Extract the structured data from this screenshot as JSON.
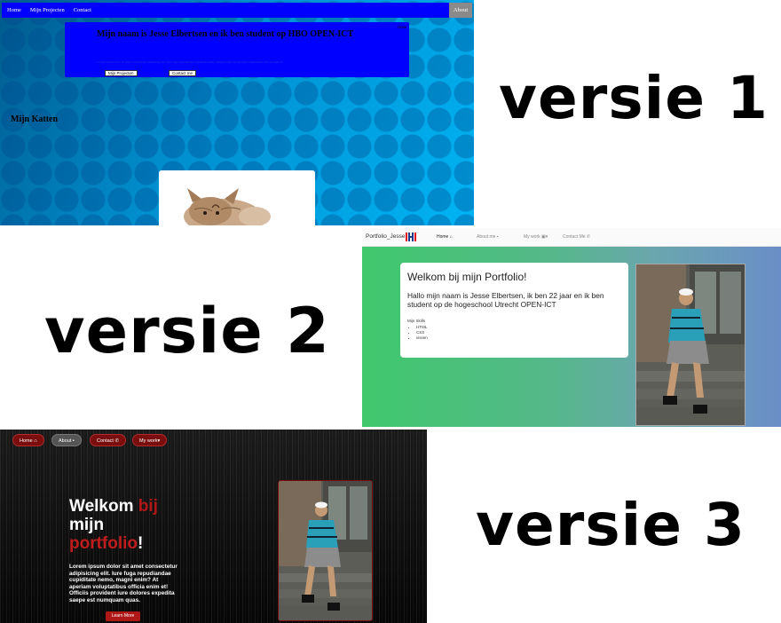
{
  "labels": {
    "versie1": "versie 1",
    "versie2": "versie 2",
    "versie3": "versie 3"
  },
  "v1": {
    "nav": [
      "Home",
      "Mijn Projecten",
      "Contact"
    ],
    "about": "About",
    "hero_title": "Mijn naam is Jesse Elbertsen en ik ben student op HBO OPEN-ICT",
    "close": "close",
    "hero_text": "Lorem ipsum dolor sit amet consectetur adipisicing elit. Iure fuga repudiandae cupiditate nemo, magni enim? At aperiam voluptatibus officia enim et!",
    "btn_projects": "Mijn Projecten",
    "btn_contact": "Contact me",
    "cats_title": "Mijn Katten",
    "colors": {
      "nav": "#0000ff",
      "background": "#00aaee"
    }
  },
  "v2": {
    "brand": "Portfolio_Jesse",
    "nav": [
      {
        "label": "Home",
        "icon": "home-icon"
      },
      {
        "label": "About me",
        "icon": "user-icon"
      },
      {
        "label": "My work",
        "icon": "image-icon"
      },
      {
        "label": "Contact Me",
        "icon": "phone-icon"
      }
    ],
    "card_title": "Welkom bij mijn Portfolio!",
    "card_intro": "Hallo mijn naam is Jesse Elbertsen, ik ben 22 jaar en ik ben student op de hogeschool Utrecht OPEN-ICT",
    "skills_title": "Mijn Skills",
    "skills": [
      "HTML",
      "CSS",
      "vissen"
    ],
    "colors": {
      "gradient_start": "#40c86c",
      "gradient_end": "#6a8ec8"
    }
  },
  "v3": {
    "nav": [
      {
        "label": "Home",
        "icon": "home-icon"
      },
      {
        "label": "About",
        "icon": "user-icon"
      },
      {
        "label": "Contact",
        "icon": "phone-icon"
      },
      {
        "label": "My work",
        "icon": "chevron-down-icon"
      }
    ],
    "heading": {
      "w1": "Welkom ",
      "w2": "bij",
      "w3": "mijn",
      "w4": "portfolio",
      "w5": "!"
    },
    "lorem": "Lorem ipsum dolor sit amet consectetur adipisicing elit. Iure fuga repudiandae cupiditate nemo, magni enim? At aperiam voluptatibus officia enim et! Officiis provident iure dolores expedita saepe est numquam quas.",
    "learn_more": "Learn More",
    "colors": {
      "accent": "#b01818",
      "background": "#0a0a0a"
    }
  }
}
